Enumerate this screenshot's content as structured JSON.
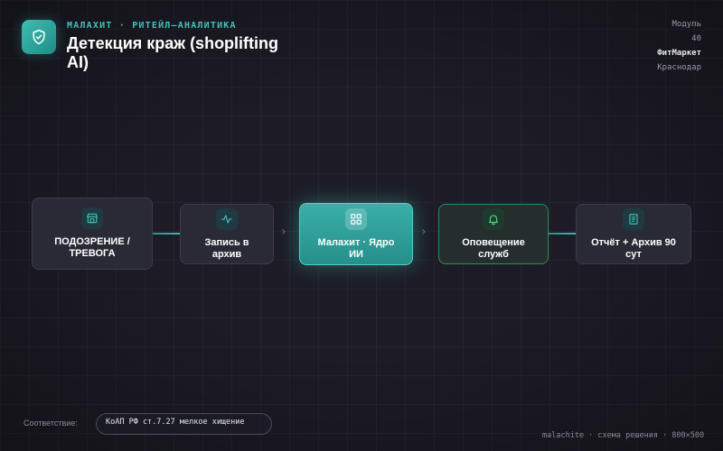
{
  "header": {
    "eyebrow": "МАЛАХИТ · РИТЕЙЛ–АНАЛИТИКА",
    "title": "Детекция краж (shoplifting AI)"
  },
  "meta": {
    "module_label": "Модуль",
    "module_number": "40",
    "client": "ФитМаркет",
    "city": "Краснодар"
  },
  "flow": {
    "nodes": [
      {
        "label": "ПОДОЗРЕНИЕ / ТРЕВОГА",
        "icon": "store-icon"
      },
      {
        "label": "Запись в архив",
        "icon": "pulse-icon"
      },
      {
        "label": "Малахит · Ядро ИИ",
        "icon": "grid-icon"
      },
      {
        "label": "Оповещение служб",
        "icon": "bell-icon"
      },
      {
        "label": "Отчёт + Архив 90 сут",
        "icon": "document-icon"
      }
    ]
  },
  "compliance": {
    "label": "Соответствие:",
    "value": "КоАП РФ ст.7.27 мелкое хищение"
  },
  "footer": {
    "text": "malachite · схема решения · 800×500"
  },
  "colors": {
    "accent": "#3fbdb3",
    "background": "#1d1c26",
    "node": "#2a2a36",
    "success_border": "#2f8a5e"
  }
}
